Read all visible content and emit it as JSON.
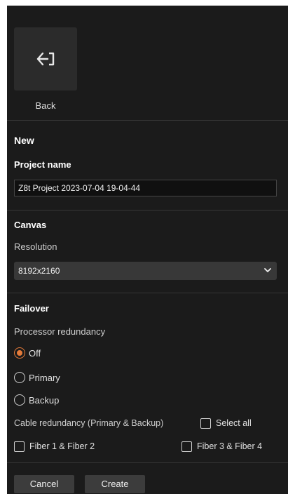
{
  "back": {
    "label": "Back",
    "icon": "exit-arrow-icon"
  },
  "new_section": {
    "title": "New"
  },
  "project": {
    "label": "Project name",
    "value": "Z8t Project 2023-07-04 19-04-44"
  },
  "canvas": {
    "title": "Canvas",
    "resolution_label": "Resolution",
    "resolution_value": "8192x2160"
  },
  "failover": {
    "title": "Failover",
    "processor_label": "Processor redundancy",
    "options": [
      {
        "label": "Off",
        "selected": true
      },
      {
        "label": "Primary",
        "selected": false
      },
      {
        "label": "Backup",
        "selected": false
      }
    ],
    "cable_label": "Cable redundancy (Primary & Backup)",
    "select_all": "Select all",
    "fiber_1_2": "Fiber 1 & Fiber 2",
    "fiber_3_4": "Fiber 3 & Fiber 4"
  },
  "actions": {
    "cancel": "Cancel",
    "create": "Create"
  },
  "colors": {
    "accent": "#e57b3a",
    "panel": "#1b1b1b"
  }
}
